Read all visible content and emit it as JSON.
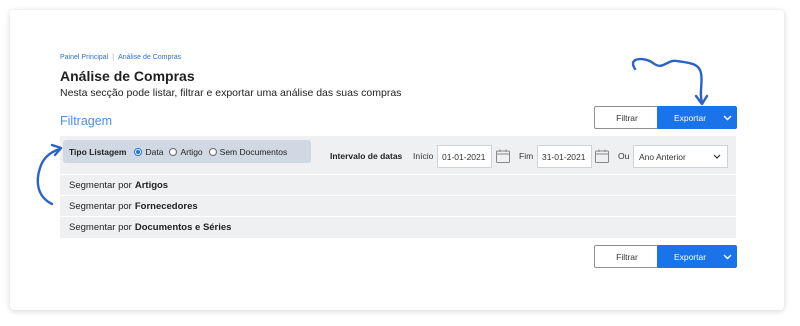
{
  "breadcrumb": {
    "items": [
      "Painel Principal",
      "Análise de Compras"
    ],
    "separator": "|"
  },
  "page": {
    "title": "Análise de Compras",
    "description": "Nesta secção pode listar, filtrar e exportar uma análise das suas compras",
    "section_title": "Filtragem"
  },
  "actions": {
    "filter_label": "Filtrar",
    "export_label": "Exportar"
  },
  "filters": {
    "tipo_label": "Tipo Listagem",
    "options": [
      "Data",
      "Artigo",
      "Sem Documentos"
    ],
    "selected": "Data",
    "interval_label": "Intervalo de datas",
    "start_label": "Início",
    "start_value": "01-01-2021",
    "end_label": "Fim",
    "end_value": "31-01-2021",
    "or_label": "Ou",
    "period_value": "Ano Anterior"
  },
  "segments": [
    {
      "prefix": "Segmentar por",
      "target": "Artigos"
    },
    {
      "prefix": "Segmentar por",
      "target": "Fornecedores"
    },
    {
      "prefix": "Segmentar por",
      "target": "Documentos e Séries"
    }
  ],
  "colors": {
    "primary": "#1a73e8",
    "accent_text": "#4a90e2",
    "panel": "#eef0f2",
    "tipo_box": "#cfd8e3"
  },
  "icons": [
    "calendar-icon",
    "chevron-down-icon",
    "curved-arrow-annotation"
  ]
}
